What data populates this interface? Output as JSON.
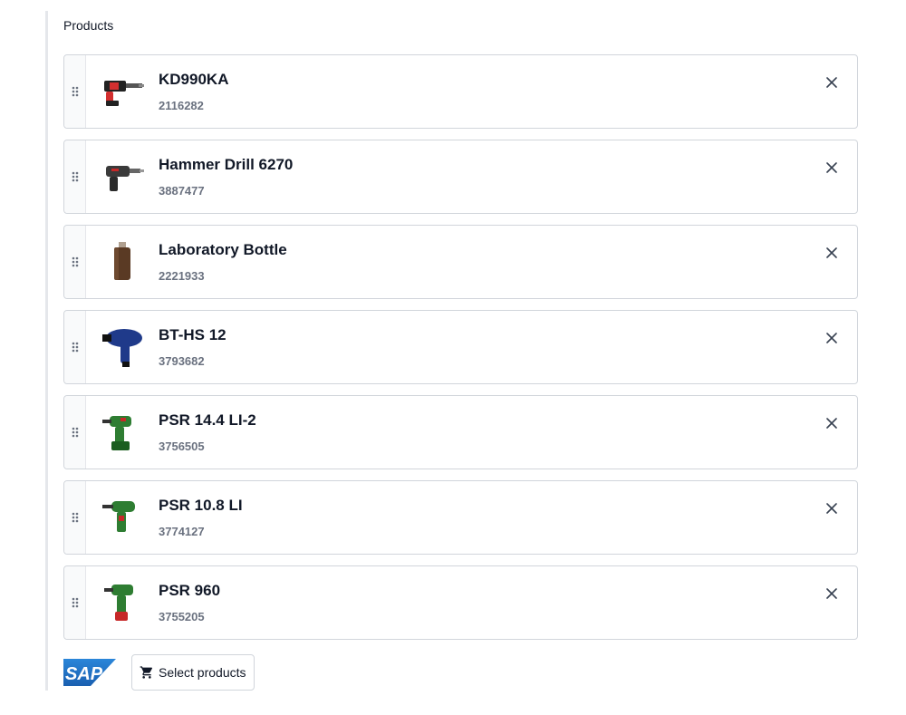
{
  "field": {
    "label": "Products"
  },
  "products": [
    {
      "name": "KD990KA",
      "sku": "2116282",
      "image_icon": "rotary-hammer-icon",
      "accent": "#d32f2f"
    },
    {
      "name": "Hammer Drill 6270",
      "sku": "3887477",
      "image_icon": "hammer-drill-icon",
      "accent": "#444444"
    },
    {
      "name": "Laboratory Bottle",
      "sku": "2221933",
      "image_icon": "bottle-icon",
      "accent": "#5a3a24"
    },
    {
      "name": "BT-HS 12",
      "sku": "3793682",
      "image_icon": "heat-gun-icon",
      "accent": "#1f3a8a"
    },
    {
      "name": "PSR 14.4 LI-2",
      "sku": "3756505",
      "image_icon": "cordless-drill-icon",
      "accent": "#2e7d32"
    },
    {
      "name": "PSR 10.8 LI",
      "sku": "3774127",
      "image_icon": "cordless-drill-icon",
      "accent": "#2e7d32"
    },
    {
      "name": "PSR 960",
      "sku": "3755205",
      "image_icon": "cordless-drill-icon",
      "accent": "#2e7d32"
    }
  ],
  "footer": {
    "logo": "SAP",
    "select_button_label": "Select products",
    "select_button_icon": "cart-icon"
  },
  "colors": {
    "border": "#d1d5db",
    "text": "#111827",
    "muted": "#6b7280",
    "sap_blue": "#1e63b6"
  }
}
